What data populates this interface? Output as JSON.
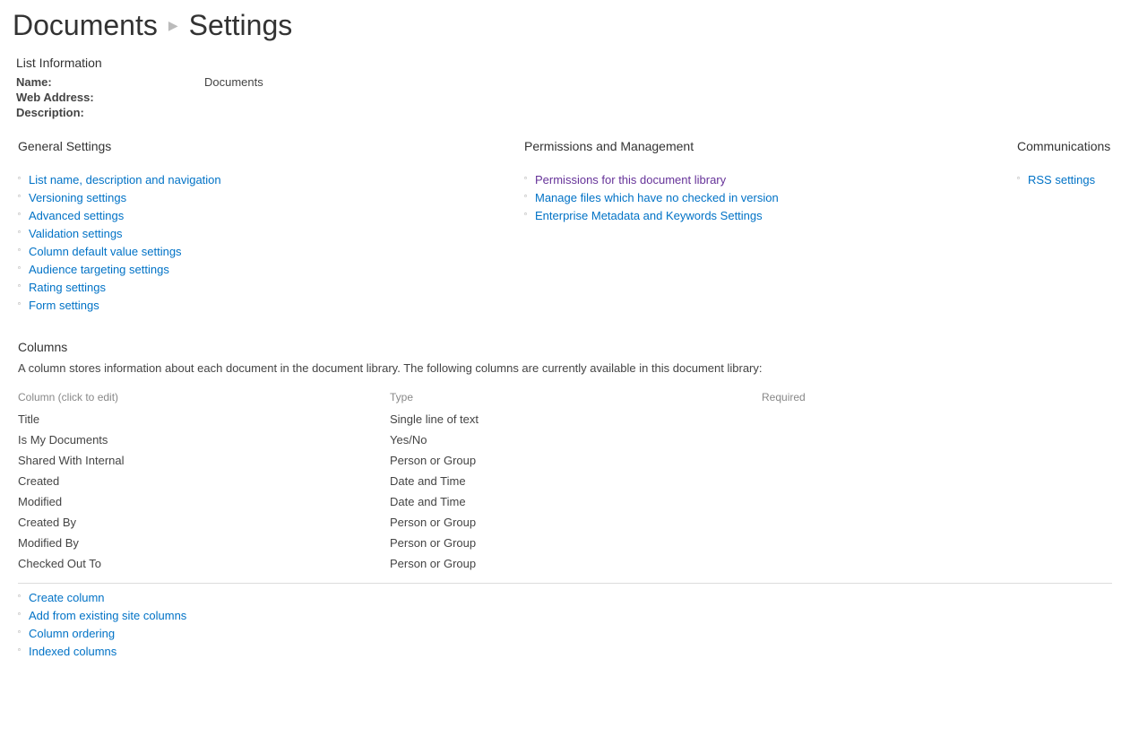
{
  "breadcrumb": {
    "library": "Documents",
    "page": "Settings"
  },
  "list_info": {
    "heading": "List Information",
    "name_label": "Name:",
    "name_value": "Documents",
    "web_label": "Web Address:",
    "web_value": "",
    "desc_label": "Description:",
    "desc_value": ""
  },
  "sections": {
    "general": {
      "heading": "General Settings",
      "links": [
        "List name, description and navigation",
        "Versioning settings",
        "Advanced settings",
        "Validation settings",
        "Column default value settings",
        "Audience targeting settings",
        "Rating settings",
        "Form settings"
      ]
    },
    "perm": {
      "heading": "Permissions and Management",
      "links": [
        "Permissions for this document library",
        "Manage files which have no checked in version",
        "Enterprise Metadata and Keywords Settings"
      ],
      "visited_first": true
    },
    "comm": {
      "heading": "Communications",
      "links": [
        "RSS settings"
      ]
    }
  },
  "columns": {
    "heading": "Columns",
    "desc": "A column stores information about each document in the document library. The following columns are currently available in this document library:",
    "th_name": "Column (click to edit)",
    "th_type": "Type",
    "th_req": "Required",
    "rows": [
      {
        "name": "Title",
        "type": "Single line of text",
        "required": ""
      },
      {
        "name": "Is My Documents",
        "type": "Yes/No",
        "required": ""
      },
      {
        "name": "Shared With Internal",
        "type": "Person or Group",
        "required": ""
      },
      {
        "name": "Created",
        "type": "Date and Time",
        "required": ""
      },
      {
        "name": "Modified",
        "type": "Date and Time",
        "required": ""
      },
      {
        "name": "Created By",
        "type": "Person or Group",
        "required": ""
      },
      {
        "name": "Modified By",
        "type": "Person or Group",
        "required": ""
      },
      {
        "name": "Checked Out To",
        "type": "Person or Group",
        "required": ""
      }
    ],
    "actions": [
      "Create column",
      "Add from existing site columns",
      "Column ordering",
      "Indexed columns"
    ]
  }
}
